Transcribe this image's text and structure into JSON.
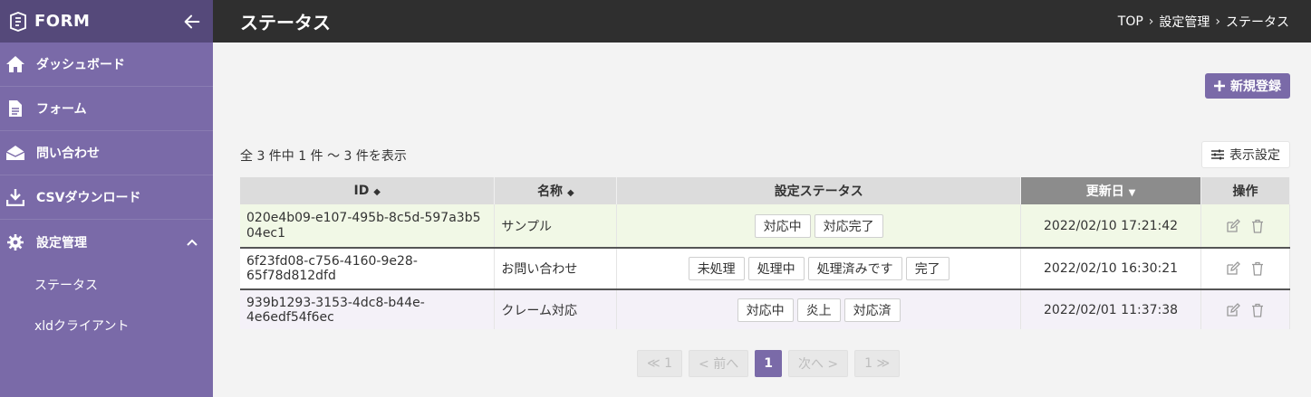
{
  "brand": {
    "title": "FORM"
  },
  "sidebar": {
    "items": [
      {
        "label": "ダッシュボード",
        "icon": "home-icon"
      },
      {
        "label": "フォーム",
        "icon": "document-icon"
      },
      {
        "label": "問い合わせ",
        "icon": "inbox-icon"
      },
      {
        "label": "CSVダウンロード",
        "icon": "download-icon"
      },
      {
        "label": "設定管理",
        "icon": "gear-icon"
      }
    ],
    "subitems": [
      {
        "label": "ステータス"
      },
      {
        "label": "xldクライアント"
      }
    ]
  },
  "header": {
    "title": "ステータス",
    "breadcrumb": [
      "TOP",
      "設定管理",
      "ステータス"
    ],
    "breadcrumb_sep": "›"
  },
  "toolbar": {
    "new_label": "新規登録",
    "count_text": "全 3 件中 1 件 ～ 3 件を表示",
    "settings_label": "表示設定"
  },
  "table": {
    "headers": {
      "id": "ID",
      "name": "名称",
      "status": "設定ステータス",
      "updated": "更新日",
      "ops": "操作"
    },
    "sort_asc_desc_glyph": "◆",
    "sort_down_glyph": "▼",
    "rows": [
      {
        "id": "020e4b09-e107-495b-8c5d-597a3b504ec1",
        "name": "サンプル",
        "statuses": [
          "対応中",
          "対応完了"
        ],
        "updated": "2022/02/10 17:21:42"
      },
      {
        "id": "6f23fd08-c756-4160-9e28-65f78d812dfd",
        "name": "お問い合わせ",
        "statuses": [
          "未処理",
          "処理中",
          "処理済みです",
          "完了"
        ],
        "updated": "2022/02/10 16:30:21"
      },
      {
        "id": "939b1293-3153-4dc8-b44e-4e6edf54f6ec",
        "name": "クレーム対応",
        "statuses": [
          "対応中",
          "炎上",
          "対応済"
        ],
        "updated": "2022/02/01 11:37:38"
      }
    ]
  },
  "pager": {
    "first": "≪ 1",
    "prev": "< 前へ",
    "current": "1",
    "next": "次へ >",
    "last": "1 ≫"
  },
  "colors": {
    "accent": "#7a6aa8",
    "header_bg": "#2f2f2f",
    "sidebar_bg": "#7a6aa8"
  }
}
